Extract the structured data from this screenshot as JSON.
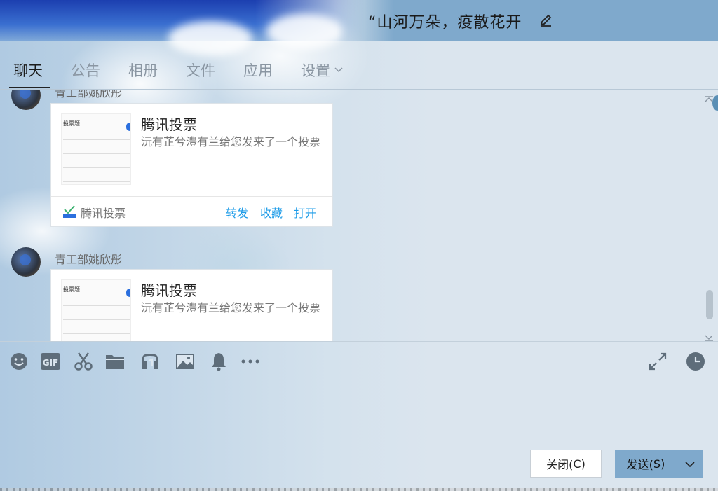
{
  "window": {
    "title": "“山河万朵，疫散花开"
  },
  "tabs": [
    {
      "label": "聊天",
      "active": true
    },
    {
      "label": "公告"
    },
    {
      "label": "相册"
    },
    {
      "label": "文件"
    },
    {
      "label": "应用"
    },
    {
      "label": "设置"
    }
  ],
  "messages": [
    {
      "sender": "青工部姚欣彤",
      "card": {
        "title": "腾讯投票",
        "description": "沅有芷兮澧有兰给您发来了一个投票",
        "thumb_title": "投票题",
        "app_name": "腾讯投票",
        "actions": [
          "转发",
          "收藏",
          "打开"
        ]
      }
    },
    {
      "sender": "青工部姚欣彤",
      "card": {
        "title": "腾讯投票",
        "description": "沅有芷兮澧有兰给您发来了一个投票",
        "thumb_title": "投票题"
      }
    }
  ],
  "toolbar": {
    "icons": [
      "emoji-icon",
      "gif-icon",
      "scissors-icon",
      "folder-icon",
      "music-icon",
      "image-icon",
      "bell-icon",
      "more-icon"
    ],
    "gif_label": "GIF"
  },
  "buttons": {
    "close_label": "关闭(",
    "close_key": "C",
    "close_end": ")",
    "send_label": "发送(",
    "send_key": "S",
    "send_end": ")"
  },
  "colors": {
    "accent": "#7fa9cc",
    "link": "#1e9ce8",
    "background": "#dce6ef"
  }
}
